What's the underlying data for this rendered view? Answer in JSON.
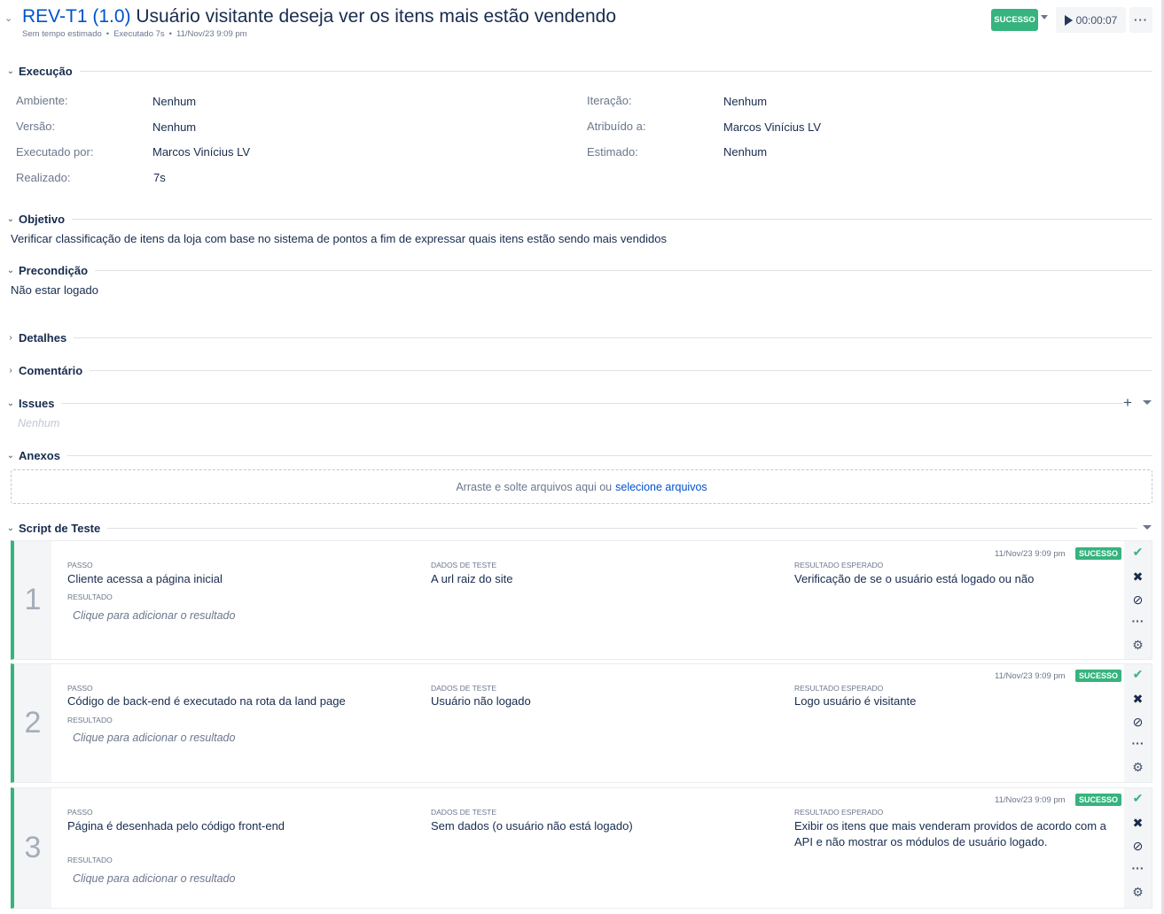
{
  "header": {
    "key": "REV-T1 (1.0)",
    "title": "Usuário visitante deseja ver os itens mais estão vendendo",
    "meta_estimate": "Sem tempo estimado",
    "meta_executed": "Executado 7s",
    "meta_date": "11/Nov/23 9:09 pm",
    "status_label": "SUCESSO",
    "timer": "00:00:07",
    "more": "···"
  },
  "sections": {
    "execucao": "Execução",
    "objetivo": "Objetivo",
    "precondicao": "Precondição",
    "detalhes": "Detalhes",
    "comentario": "Comentário",
    "issues": "Issues",
    "anexos": "Anexos",
    "script": "Script de Teste"
  },
  "execution": {
    "left": [
      {
        "label": "Ambiente:",
        "value": "Nenhum"
      },
      {
        "label": "Versão:",
        "value": "Nenhum"
      },
      {
        "label": "Executado por:",
        "value": "Marcos Vinícius LV"
      },
      {
        "label": "Realizado:",
        "value": "7s"
      }
    ],
    "right": [
      {
        "label": "Iteração:",
        "value": "Nenhum"
      },
      {
        "label": "Atribuído a:",
        "value": "Marcos Vinícius LV"
      },
      {
        "label": "Estimado:",
        "value": "Nenhum"
      }
    ]
  },
  "objective_text": "Verificar classificação de itens da loja com base no sistema de pontos a fim de expressar quais itens estão sendo mais vendidos",
  "precondition_text": "Não estar logado",
  "issues_empty": "Nenhum",
  "attachments": {
    "text": "Arraste e solte arquivos aqui ou",
    "link": "selecione arquivos"
  },
  "step_captions": {
    "step": "PASSO",
    "data": "DADOS DE TESTE",
    "expected": "RESULTADO ESPERADO",
    "result": "RESULTADO",
    "result_placeholder": "Clique para adicionar o resultado"
  },
  "steps": [
    {
      "number": "1",
      "step": "Cliente acessa a página inicial",
      "data": "A url raiz do site",
      "expected": "Verificação de se o usuário está logado ou não",
      "date": "11/Nov/23 9:09 pm",
      "status": "SUCESSO"
    },
    {
      "number": "2",
      "step": "Código de back-end é executado na rota da land page",
      "data": "Usuário não logado",
      "expected": "Logo usuário é visitante",
      "date": "11/Nov/23 9:09 pm",
      "status": "SUCESSO"
    },
    {
      "number": "3",
      "step": "Página é desenhada pelo código front-end",
      "data": "Sem dados (o usuário não está logado)",
      "expected": "Exibir os itens que mais venderam providos de acordo com a API e não mostrar os módulos de usuário logado.",
      "date": "11/Nov/23 9:09 pm",
      "status": "SUCESSO"
    }
  ],
  "colors": {
    "success": "#36b37e",
    "link": "#0052cc",
    "fail": "#172b4d"
  }
}
